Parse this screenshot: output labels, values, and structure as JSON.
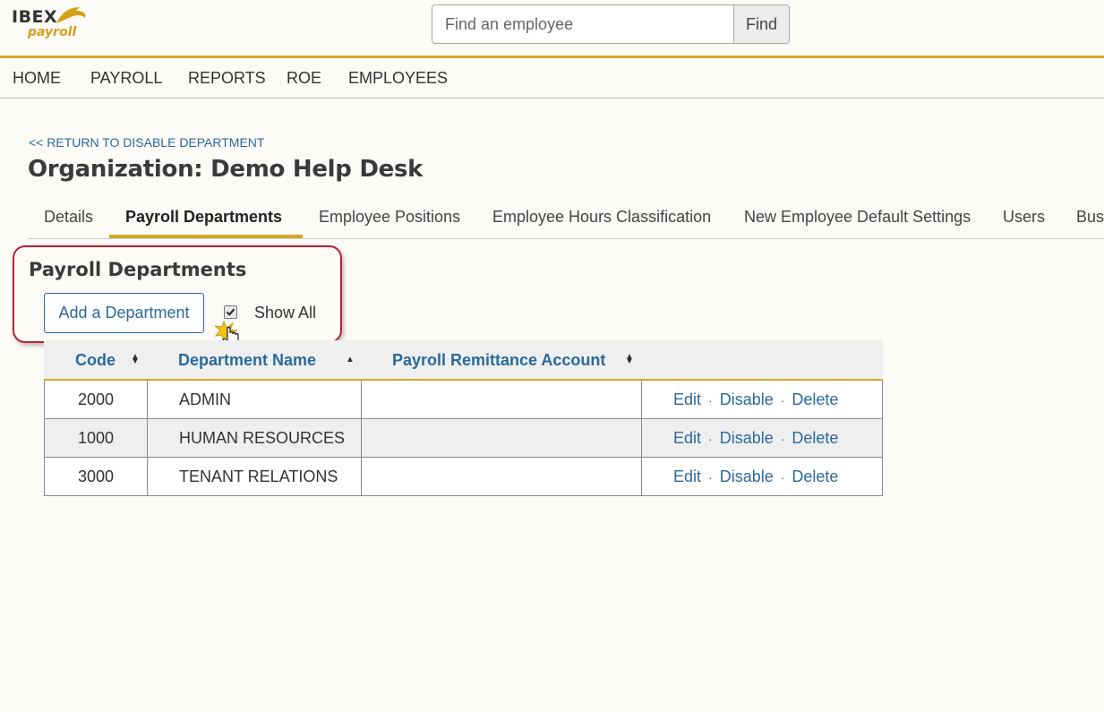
{
  "header": {
    "logo_text": "IBEX",
    "logo_subtext": "payroll",
    "search_placeholder": "Find an employee",
    "search_button": "Find"
  },
  "nav": [
    "HOME",
    "PAYROLL",
    "REPORTS",
    "ROE",
    "EMPLOYEES"
  ],
  "return_link": "<< RETURN TO DISABLE DEPARTMENT",
  "page_title": "Organization: Demo Help Desk",
  "tabs": [
    {
      "label": "Details"
    },
    {
      "label": "Payroll Departments",
      "active": true
    },
    {
      "label": "Employee Positions"
    },
    {
      "label": "Employee Hours Classification"
    },
    {
      "label": "New Employee Default Settings"
    },
    {
      "label": "Users"
    },
    {
      "label": "Bus"
    }
  ],
  "section": {
    "title": "Payroll Departments",
    "add_button": "Add a Department",
    "show_all_label": "Show All",
    "show_all_checked": true
  },
  "table": {
    "columns": [
      "Code",
      "Department Name",
      "Payroll Remittance Account"
    ],
    "sort_icons": [
      "sort-both-icon",
      "sort-ascending-icon",
      "sort-both-icon"
    ],
    "rows": [
      {
        "code": "2000",
        "name": "ADMIN",
        "account": ""
      },
      {
        "code": "1000",
        "name": "HUMAN RESOURCES",
        "account": ""
      },
      {
        "code": "3000",
        "name": "TENANT RELATIONS",
        "account": ""
      }
    ],
    "actions": {
      "edit": "Edit",
      "disable": "Disable",
      "delete": "Delete",
      "separator": "·"
    }
  },
  "colors": {
    "accent_gold": "#d4a52b",
    "link_blue": "#2a6a9c",
    "highlight_red": "#b52233",
    "row_alt": "#efefef"
  }
}
